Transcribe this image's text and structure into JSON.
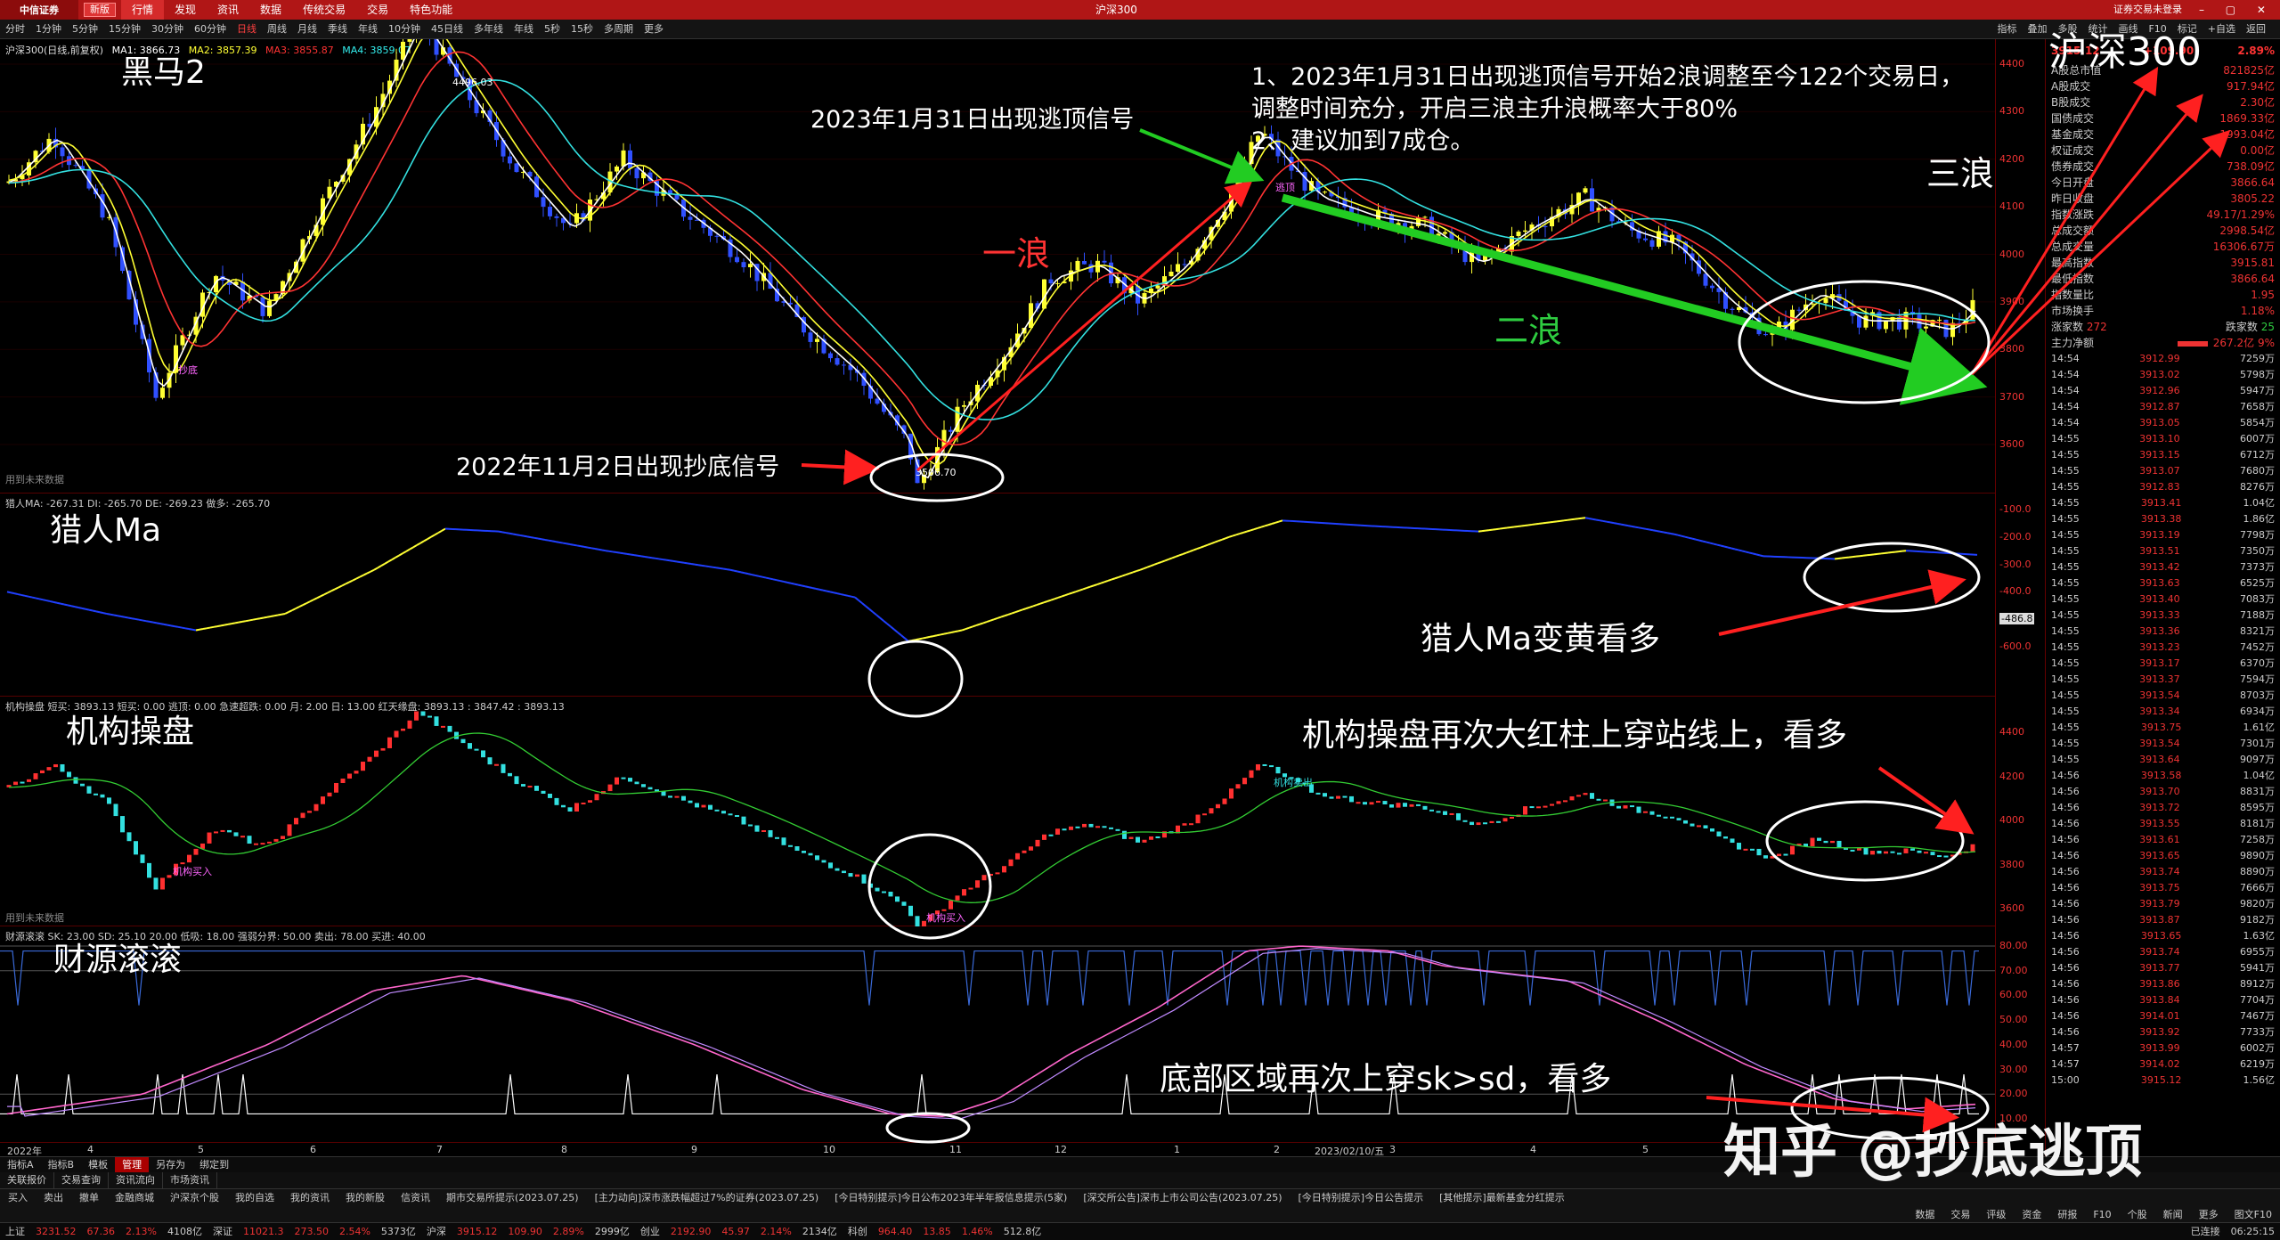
{
  "topbar": {
    "logo": "中信证券",
    "version": "新版",
    "menu": [
      "行情",
      "发现",
      "资讯",
      "数据",
      "传统交易",
      "交易",
      "特色功能"
    ],
    "center_title": "沪深300",
    "right_text": "证券交易未登录",
    "win_buttons": "– ▢ ✕"
  },
  "periodbar": {
    "periods": [
      "分时",
      "1分钟",
      "5分钟",
      "15分钟",
      "30分钟",
      "60分钟",
      "日线",
      "周线",
      "月线",
      "季线",
      "年线",
      "10分钟",
      "45日线",
      "多年线",
      "年线",
      "5秒",
      "15秒",
      "多周期",
      "更多"
    ],
    "active_index": 6,
    "tools": [
      "指标",
      "叠加",
      "多股",
      "统计",
      "画线",
      "F10",
      "标记",
      "+自选",
      "返回"
    ]
  },
  "main": {
    "legend": {
      "title": "沪深300(日线,前复权)",
      "ma": [
        {
          "label": "MA1: 3866.73",
          "color": "#ffffff"
        },
        {
          "label": "MA2: 3857.39",
          "color": "#ffff33"
        },
        {
          "label": "MA3: 3855.87",
          "color": "#ff3333"
        },
        {
          "label": "MA4: 3859.07",
          "color": "#33e0e0"
        }
      ]
    },
    "overlay_title": "黑马2",
    "yaxis": [
      "4400",
      "4300",
      "4200",
      "4100",
      "4000",
      "3900",
      "3800",
      "3700",
      "3600"
    ],
    "high_label": "4496.03",
    "low_label": "3506.70",
    "buy_label": "抄底",
    "escape_label": "逃顶",
    "footnote": "用到未来数据",
    "annotations": {
      "note1": "1、2023年1月31日出现逃顶信号开始2浪调整至今122个交易日，",
      "note2": "调整时间充分，开启三浪主升浪概率大于80%",
      "note3": "2、建议加到7成仓。",
      "top_signal": "2023年1月31日出现逃顶信号",
      "bottom_signal": "2022年11月2日出现抄底信号",
      "wave1": "一浪",
      "wave2": "二浪",
      "wave3": "三浪主升",
      "index_name": "沪深300"
    }
  },
  "lierenma": {
    "legend": "猎人MA: -267.31  DI: -265.70  DE: -269.23  做多: -265.70",
    "overlay_title": "猎人Ma",
    "yaxis": [
      "-100.0",
      "-200.0",
      "-300.0",
      "-400.0",
      "-500.0",
      "-600.0"
    ],
    "current": "-486.8",
    "annotation": "猎人Ma变黄看多"
  },
  "jigou": {
    "legend": "机构操盘  短买: 3893.13  短买: 0.00  逃顶: 0.00  急速超跌: 0.00  月: 2.00  日: 13.00  红天缘盘: 3893.13 : 3847.42 : 3893.13",
    "overlay_title": "机构操盘",
    "yaxis": [
      "4400",
      "4200",
      "4000",
      "3800",
      "3600"
    ],
    "buy_label": "机构买入",
    "sell_label": "机构卖出",
    "footnote": "用到未来数据",
    "annotation": "机构操盘再次大红柱上穿站线上，看多"
  },
  "caiyuan": {
    "legend": "财源滚滚  SK: 23.00  SD: 25.10  20.00  低吸: 18.00  强弱分界: 50.00  卖出: 78.00  买进: 40.00",
    "overlay_title": "财源滚滚",
    "yaxis": [
      "80.00",
      "70.00",
      "60.00",
      "50.00",
      "40.00",
      "30.00",
      "20.00",
      "10.00"
    ],
    "annotation": "底部区域再次上穿sk>sd，看多"
  },
  "xaxis": {
    "labels": [
      "2022年",
      "4",
      "5",
      "6",
      "7",
      "8",
      "9",
      "10",
      "11",
      "12",
      "1",
      "2",
      "2023/02/10/五",
      "3",
      "4",
      "5",
      "6",
      "7"
    ]
  },
  "side": {
    "title": "沪深300",
    "price": "3915.12",
    "change": "+109.90",
    "pct": "2.89%",
    "rows": [
      {
        "k": "A股总市值",
        "v": "821825亿"
      },
      {
        "k": "A股成交",
        "v": "917.94亿"
      },
      {
        "k": "B股成交",
        "v": "2.30亿"
      },
      {
        "k": "国债成交",
        "v": "1869.33亿"
      },
      {
        "k": "基金成交",
        "v": "1993.04亿"
      },
      {
        "k": "权证成交",
        "v": "0.00亿"
      },
      {
        "k": "债券成交",
        "v": "738.09亿"
      },
      {
        "k": "今日开盘",
        "v": "3866.64"
      },
      {
        "k": "昨日收盘",
        "v": "3805.22"
      },
      {
        "k": "指数涨跌",
        "v": "49.17/1.29%"
      },
      {
        "k": "总成交额",
        "v": "2998.54亿"
      },
      {
        "k": "总成交量",
        "v": "16306.67万"
      },
      {
        "k": "最高指数",
        "v": "3915.81"
      },
      {
        "k": "最低指数",
        "v": "3866.64"
      },
      {
        "k": "指数量比",
        "v": "1.95"
      },
      {
        "k": "市场换手",
        "v": "1.18%"
      }
    ],
    "up_count_label": "涨家数",
    "up_count": "272",
    "down_count_label": "跌家数",
    "down_count": "25",
    "mainforce_label": "主力净额",
    "mainforce": "267.2亿",
    "mainforce_pct": "9%",
    "ticks": [
      {
        "t": "14:54",
        "p": "3912.99",
        "v": "7259万"
      },
      {
        "t": "14:54",
        "p": "3913.02",
        "v": "5798万"
      },
      {
        "t": "14:54",
        "p": "3912.96",
        "v": "5947万"
      },
      {
        "t": "14:54",
        "p": "3912.87",
        "v": "7658万"
      },
      {
        "t": "14:54",
        "p": "3913.05",
        "v": "5854万"
      },
      {
        "t": "14:55",
        "p": "3913.10",
        "v": "6007万"
      },
      {
        "t": "14:55",
        "p": "3913.15",
        "v": "6712万"
      },
      {
        "t": "14:55",
        "p": "3913.07",
        "v": "7680万"
      },
      {
        "t": "14:55",
        "p": "3912.83",
        "v": "8276万"
      },
      {
        "t": "14:55",
        "p": "3913.41",
        "v": "1.04亿"
      },
      {
        "t": "14:55",
        "p": "3913.38",
        "v": "1.86亿"
      },
      {
        "t": "14:55",
        "p": "3913.19",
        "v": "7798万"
      },
      {
        "t": "14:55",
        "p": "3913.51",
        "v": "7350万"
      },
      {
        "t": "14:55",
        "p": "3913.42",
        "v": "7373万"
      },
      {
        "t": "14:55",
        "p": "3913.63",
        "v": "6525万"
      },
      {
        "t": "14:55",
        "p": "3913.40",
        "v": "7083万"
      },
      {
        "t": "14:55",
        "p": "3913.33",
        "v": "7188万"
      },
      {
        "t": "14:55",
        "p": "3913.36",
        "v": "8321万"
      },
      {
        "t": "14:55",
        "p": "3913.23",
        "v": "7452万"
      },
      {
        "t": "14:55",
        "p": "3913.17",
        "v": "6370万"
      },
      {
        "t": "14:55",
        "p": "3913.37",
        "v": "7594万"
      },
      {
        "t": "14:55",
        "p": "3913.54",
        "v": "8703万"
      },
      {
        "t": "14:55",
        "p": "3913.34",
        "v": "6934万"
      },
      {
        "t": "14:55",
        "p": "3913.75",
        "v": "1.61亿"
      },
      {
        "t": "14:55",
        "p": "3913.54",
        "v": "7301万"
      },
      {
        "t": "14:55",
        "p": "3913.64",
        "v": "9097万"
      },
      {
        "t": "14:56",
        "p": "3913.58",
        "v": "1.04亿"
      },
      {
        "t": "14:56",
        "p": "3913.70",
        "v": "8831万"
      },
      {
        "t": "14:56",
        "p": "3913.72",
        "v": "8595万"
      },
      {
        "t": "14:56",
        "p": "3913.55",
        "v": "8181万"
      },
      {
        "t": "14:56",
        "p": "3913.61",
        "v": "7258万"
      },
      {
        "t": "14:56",
        "p": "3913.65",
        "v": "9890万"
      },
      {
        "t": "14:56",
        "p": "3913.74",
        "v": "8890万"
      },
      {
        "t": "14:56",
        "p": "3913.75",
        "v": "7666万"
      },
      {
        "t": "14:56",
        "p": "3913.79",
        "v": "9820万"
      },
      {
        "t": "14:56",
        "p": "3913.87",
        "v": "9182万"
      },
      {
        "t": "14:56",
        "p": "3913.65",
        "v": "1.63亿"
      },
      {
        "t": "14:56",
        "p": "3913.74",
        "v": "6955万"
      },
      {
        "t": "14:56",
        "p": "3913.77",
        "v": "5941万"
      },
      {
        "t": "14:56",
        "p": "3913.86",
        "v": "8912万"
      },
      {
        "t": "14:56",
        "p": "3913.84",
        "v": "7704万"
      },
      {
        "t": "14:56",
        "p": "3914.01",
        "v": "7467万"
      },
      {
        "t": "14:56",
        "p": "3913.92",
        "v": "7733万"
      },
      {
        "t": "14:57",
        "p": "3913.99",
        "v": "6002万"
      },
      {
        "t": "14:57",
        "p": "3914.02",
        "v": "6219万"
      },
      {
        "t": "15:00",
        "p": "3915.12",
        "v": "1.56亿"
      }
    ]
  },
  "bottomtabs": [
    "指标A",
    "指标B",
    "模板",
    "管理",
    "另存为",
    "绑定到"
  ],
  "bottomtabs_active": 3,
  "funcbar": [
    "关联报价",
    "交易查询",
    "资讯流向",
    "市场资讯"
  ],
  "toolbar2": {
    "row1": [
      "买入",
      "卖出",
      "撤单",
      "金融商城",
      "沪深京个股",
      "我的自选",
      "我的资讯",
      "我的新股",
      "信资讯",
      "期市交易所提示(2023.07.25)",
      "[主力动向]深市涨跌幅超过7%的证券(2023.07.25)",
      "[今日特别提示]今日公布2023年半年报信息提示(5家)",
      "[深交所公告]深市上市公司公告(2023.07.25)",
      "[今日特别提示]今日公告提示",
      "[其他提示]最新基金分红提示"
    ],
    "row2": [
      "数据",
      "交易",
      "评级",
      "资金",
      "研报",
      "F10",
      "个股",
      "新闻",
      "更多",
      "图文F10"
    ]
  },
  "status": {
    "items": [
      {
        "label": "上证",
        "value": "3231.52",
        "chg": "67.36",
        "pct": "2.13%",
        "amt": "4108亿"
      },
      {
        "label": "深证",
        "value": "11021.3",
        "chg": "273.50",
        "pct": "2.54%",
        "amt": "5373亿"
      },
      {
        "label": "沪深",
        "value": "3915.12",
        "chg": "109.90",
        "pct": "2.89%",
        "amt": "2999亿"
      },
      {
        "label": "创业",
        "value": "2192.90",
        "chg": "45.97",
        "pct": "2.14%",
        "amt": "2134亿"
      },
      {
        "label": "科创",
        "value": "964.40",
        "chg": "13.85",
        "pct": "1.46%",
        "amt": "512.8亿"
      }
    ],
    "connection": "已连接",
    "time": "06:25:15"
  },
  "watermark": "知乎 @抄底逃顶"
}
